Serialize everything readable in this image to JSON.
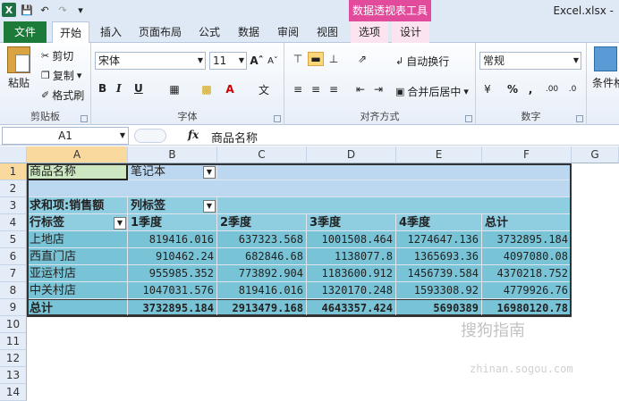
{
  "window": {
    "title": "Excel.xlsx -",
    "context_group": "数据透视表工具"
  },
  "tabs": {
    "file": "文件",
    "home": "开始",
    "insert": "插入",
    "layout": "页面布局",
    "formulas": "公式",
    "data": "数据",
    "review": "审阅",
    "view": "视图",
    "options": "选项",
    "design": "设计"
  },
  "ribbon": {
    "clipboard": {
      "label": "剪贴板",
      "paste": "粘贴",
      "cut": "剪切",
      "copy": "复制",
      "format_painter": "格式刷"
    },
    "font": {
      "label": "字体",
      "name": "宋体",
      "size": "11",
      "bold": "B",
      "italic": "I",
      "underline": "U"
    },
    "alignment": {
      "label": "对齐方式",
      "wrap": "自动换行",
      "merge": "合并后居中"
    },
    "number": {
      "label": "数字",
      "format": "常规",
      "percent": "%",
      "comma": ",",
      "inc_dec": ".00",
      "dec_dec": ".0"
    },
    "styles": {
      "conditional": "条件格"
    }
  },
  "formula_bar": {
    "name_box": "A1",
    "fx": "fx",
    "content": "商品名称"
  },
  "columns": [
    "A",
    "B",
    "C",
    "D",
    "E",
    "F",
    "G"
  ],
  "rows": [
    "1",
    "2",
    "3",
    "4",
    "5",
    "6",
    "7",
    "8",
    "9",
    "10",
    "11",
    "12",
    "13",
    "14"
  ],
  "pivot": {
    "filter_label": "商品名称",
    "filter_value": "笔记本",
    "values_label": "求和项:销售额",
    "col_labels": "列标签",
    "row_labels": "行标签",
    "headers": [
      "1季度",
      "2季度",
      "3季度",
      "4季度",
      "总计"
    ],
    "data": [
      {
        "name": "上地店",
        "vals": [
          "819416.016",
          "637323.568",
          "1001508.464",
          "1274647.136",
          "3732895.184"
        ]
      },
      {
        "name": "西直门店",
        "vals": [
          "910462.24",
          "682846.68",
          "1138077.8",
          "1365693.36",
          "4097080.08"
        ]
      },
      {
        "name": "亚运村店",
        "vals": [
          "955985.352",
          "773892.904",
          "1183600.912",
          "1456739.584",
          "4370218.752"
        ]
      },
      {
        "name": "中关村店",
        "vals": [
          "1047031.576",
          "819416.016",
          "1320170.248",
          "1593308.92",
          "4779926.76"
        ]
      }
    ],
    "total": {
      "name": "总计",
      "vals": [
        "3732895.184",
        "2913479.168",
        "4643357.424",
        "5690389",
        "16980120.78"
      ]
    }
  },
  "watermark": {
    "text": "搜狗指南",
    "sub": "zhinan.sogou.com"
  }
}
